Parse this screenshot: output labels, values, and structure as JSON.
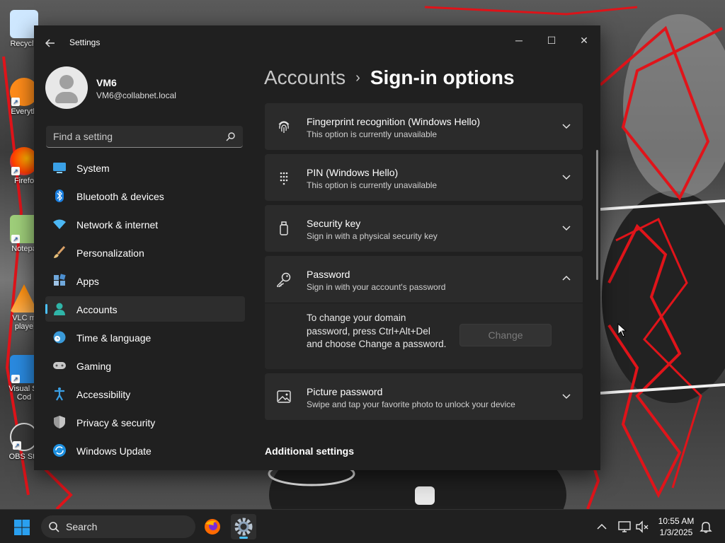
{
  "window": {
    "app_title": "Settings",
    "controls": {
      "minimize": "─",
      "maximize": "☐",
      "close": "✕"
    }
  },
  "desktop": {
    "icons": [
      {
        "label": "Recycle",
        "icon": "recycle-bin-icon",
        "color": "#cfe8ff"
      },
      {
        "label": "Everyth",
        "icon": "everything-search-icon",
        "color": "#ff8c1a"
      },
      {
        "label": "Firefo",
        "icon": "firefox-icon",
        "color": "#ff6a00"
      },
      {
        "label": "Notepa",
        "icon": "notepad-icon",
        "color": "#9fcf7a"
      },
      {
        "label": "VLC m",
        "label2": "playe",
        "icon": "vlc-icon",
        "color": "#ff8800"
      },
      {
        "label": "Visual St",
        "label2": "Cod",
        "icon": "vscode-icon",
        "color": "#2a8ae0"
      },
      {
        "label": "OBS Stu",
        "icon": "obs-icon",
        "color": "#3a3a3a"
      }
    ]
  },
  "profile": {
    "name": "VM6",
    "email": "VM6@collabnet.local"
  },
  "search": {
    "placeholder": "Find a setting"
  },
  "nav": {
    "active_index": 5,
    "items": [
      {
        "label": "System",
        "icon": "system-icon"
      },
      {
        "label": "Bluetooth & devices",
        "icon": "bluetooth-icon"
      },
      {
        "label": "Network & internet",
        "icon": "network-icon"
      },
      {
        "label": "Personalization",
        "icon": "brush-icon"
      },
      {
        "label": "Apps",
        "icon": "apps-icon"
      },
      {
        "label": "Accounts",
        "icon": "accounts-icon"
      },
      {
        "label": "Time & language",
        "icon": "time-language-icon"
      },
      {
        "label": "Gaming",
        "icon": "gaming-icon"
      },
      {
        "label": "Accessibility",
        "icon": "accessibility-icon"
      },
      {
        "label": "Privacy & security",
        "icon": "shield-icon"
      },
      {
        "label": "Windows Update",
        "icon": "windows-update-icon"
      }
    ]
  },
  "breadcrumb": {
    "parent": "Accounts",
    "separator": "›",
    "current": "Sign-in options"
  },
  "options": [
    {
      "title": "Fingerprint recognition (Windows Hello)",
      "subtitle": "This option is currently unavailable",
      "icon": "fingerprint-icon",
      "expanded": false
    },
    {
      "title": "PIN (Windows Hello)",
      "subtitle": "This option is currently unavailable",
      "icon": "pin-keypad-icon",
      "expanded": false
    },
    {
      "title": "Security key",
      "subtitle": "Sign in with a physical security key",
      "icon": "security-key-icon",
      "expanded": false
    },
    {
      "title": "Password",
      "subtitle": "Sign in with your account's password",
      "icon": "key-icon",
      "expanded": true
    },
    {
      "title": "Picture password",
      "subtitle": "Swipe and tap your favorite photo to unlock your device",
      "icon": "picture-icon",
      "expanded": false
    }
  ],
  "password_panel": {
    "description": "To change your domain password, press Ctrl+Alt+Del and choose Change a password.",
    "button_label": "Change",
    "button_enabled": false
  },
  "additional_settings": {
    "heading": "Additional settings"
  },
  "taskbar": {
    "search_label": "Search",
    "apps": [
      {
        "icon": "firefox-icon",
        "active": false
      },
      {
        "icon": "settings-gear-icon",
        "active": true
      }
    ],
    "tray": [
      "chevron-up-icon",
      "network-icon",
      "volume-muted-icon",
      "notification-bell-icon"
    ],
    "time": "10:55 AM",
    "date": "1/3/2025"
  },
  "colors": {
    "accent": "#4cc2ff",
    "window_bg": "#202020",
    "card_bg": "#2b2b2b",
    "desktop_scribble": "#e0141a"
  }
}
